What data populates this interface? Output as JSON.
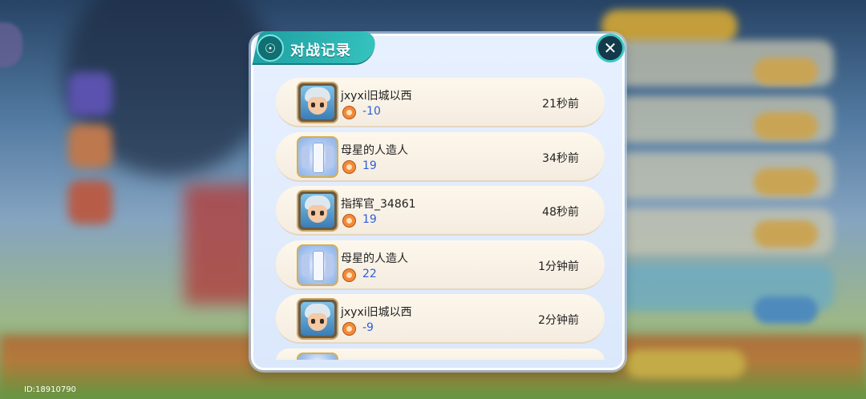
{
  "dialog": {
    "title": "对战记录",
    "title_icon": "lightbulb-icon",
    "close_icon": "close-icon"
  },
  "records": [
    {
      "name": "jxyxi旧城以西",
      "score": "-10",
      "time": "21秒前",
      "avatar": "boy-hero-avatar"
    },
    {
      "name": "母星的人造人",
      "score": "19",
      "time": "34秒前",
      "avatar": "tower-frame-avatar"
    },
    {
      "name": "指挥官_34861",
      "score": "19",
      "time": "48秒前",
      "avatar": "boy-hero-avatar"
    },
    {
      "name": "母星的人造人",
      "score": "22",
      "time": "1分钟前",
      "avatar": "tower-frame-avatar"
    },
    {
      "name": "jxyxi旧城以西",
      "score": "-9",
      "time": "2分钟前",
      "avatar": "boy-hero-avatar"
    }
  ],
  "footer": {
    "id_label": "ID:18910790"
  },
  "colors": {
    "title_tab": "#2bb3b0",
    "score_text": "#2b5fd9",
    "row_bg": "#fbf3e8",
    "dialog_bg": "#e3edfd"
  }
}
